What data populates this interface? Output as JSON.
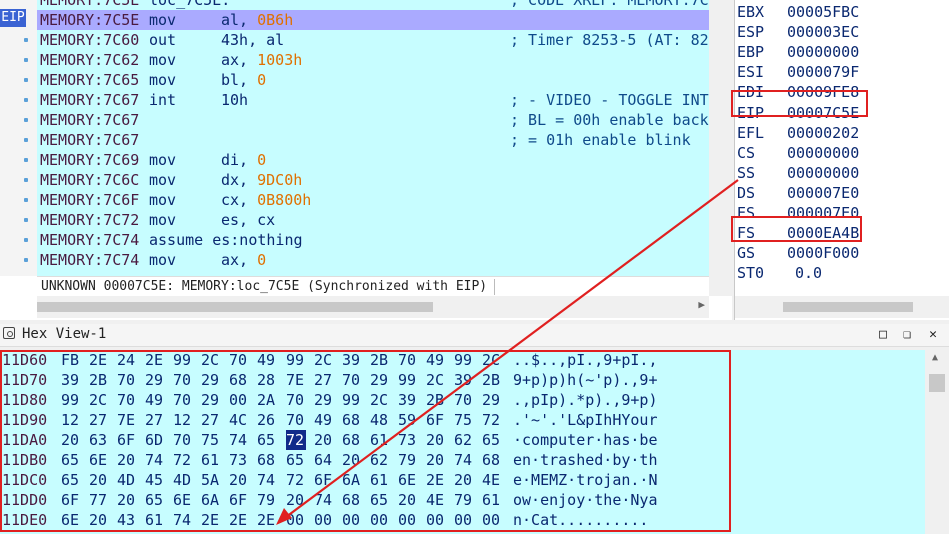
{
  "disassembly": {
    "eip_tag": "EIP",
    "lines": [
      {
        "addr": "MEMORY:7C5E",
        "mn": "loc_7C5E:",
        "op": "",
        "opnum": "",
        "cm": "; CODE XREF: MEMORY:7C"
      },
      {
        "addr": "MEMORY:7C5E",
        "mn": "mov",
        "op": "al, ",
        "opnum": "0B6h",
        "cm": ""
      },
      {
        "addr": "MEMORY:7C60",
        "mn": "out",
        "op": "43h, al",
        "opnum": "",
        "cm": "; Timer 8253-5 (AT: 82"
      },
      {
        "addr": "MEMORY:7C62",
        "mn": "mov",
        "op": "ax, ",
        "opnum": "1003h",
        "cm": ""
      },
      {
        "addr": "MEMORY:7C65",
        "mn": "mov",
        "op": "bl, ",
        "opnum": "0",
        "cm": ""
      },
      {
        "addr": "MEMORY:7C67",
        "mn": "int",
        "op": "10h",
        "opnum": "",
        "cm": "; - VIDEO - TOGGLE INT"
      },
      {
        "addr": "MEMORY:7C67",
        "mn": "",
        "op": "",
        "opnum": "",
        "cm": "; BL = 00h enable back"
      },
      {
        "addr": "MEMORY:7C67",
        "mn": "",
        "op": "",
        "opnum": "",
        "cm": "; = 01h enable blink"
      },
      {
        "addr": "MEMORY:7C69",
        "mn": "mov",
        "op": "di, ",
        "opnum": "0",
        "cm": ""
      },
      {
        "addr": "MEMORY:7C6C",
        "mn": "mov",
        "op": "dx, ",
        "opnum": "9DC0h",
        "cm": ""
      },
      {
        "addr": "MEMORY:7C6F",
        "mn": "mov",
        "op": "cx, ",
        "opnum": "0B800h",
        "cm": ""
      },
      {
        "addr": "MEMORY:7C72",
        "mn": "mov",
        "op": "es, cx",
        "opnum": "",
        "cm": ""
      },
      {
        "addr": "MEMORY:7C74",
        "mn": "assume es:nothing",
        "op": "",
        "opnum": "",
        "cm": ""
      },
      {
        "addr": "MEMORY:7C74",
        "mn": "mov",
        "op": "ax, ",
        "opnum": "0",
        "cm": ""
      }
    ],
    "status": "UNKNOWN 00007C5E: MEMORY:loc_7C5E (Synchronized with EIP)"
  },
  "registers": [
    {
      "name": "EBX",
      "value": "00005FBC"
    },
    {
      "name": "ESP",
      "value": "000003EC"
    },
    {
      "name": "EBP",
      "value": "00000000"
    },
    {
      "name": "ESI",
      "value": "0000079F"
    },
    {
      "name": "EDI",
      "value": "00009FE8"
    },
    {
      "name": "EIP",
      "value": "00007C5E"
    },
    {
      "name": "EFL",
      "value": "00000202"
    },
    {
      "name": "CS",
      "value": "00000000"
    },
    {
      "name": "SS",
      "value": "00000000"
    },
    {
      "name": "DS",
      "value": "000007E0"
    },
    {
      "name": "ES",
      "value": "000007E0"
    },
    {
      "name": "FS",
      "value": "0000EA4B"
    },
    {
      "name": "GS",
      "value": "0000F000"
    },
    {
      "name": "ST0",
      "value": "0.0"
    }
  ],
  "hexview": {
    "title": "Hex View-1",
    "selected_byte": "72",
    "rows": [
      {
        "addr": "11D60",
        "bytes": [
          "FB",
          "2E",
          "24",
          "2E",
          "99",
          "2C",
          "70",
          "49",
          "99",
          "2C",
          "39",
          "2B",
          "70",
          "49",
          "99",
          "2C"
        ],
        "ascii": "..$..,pI.,9+pI.,"
      },
      {
        "addr": "11D70",
        "bytes": [
          "39",
          "2B",
          "70",
          "29",
          "70",
          "29",
          "68",
          "28",
          "7E",
          "27",
          "70",
          "29",
          "99",
          "2C",
          "39",
          "2B"
        ],
        "ascii": "9+p)p)h(~'p).,9+"
      },
      {
        "addr": "11D80",
        "bytes": [
          "99",
          "2C",
          "70",
          "49",
          "70",
          "29",
          "00",
          "2A",
          "70",
          "29",
          "99",
          "2C",
          "39",
          "2B",
          "70",
          "29"
        ],
        "ascii": ".,pIp).*p).,9+p)"
      },
      {
        "addr": "11D90",
        "bytes": [
          "12",
          "27",
          "7E",
          "27",
          "12",
          "27",
          "4C",
          "26",
          "70",
          "49",
          "68",
          "48",
          "59",
          "6F",
          "75",
          "72"
        ],
        "ascii": ".'~'.'L&pIhHYour"
      },
      {
        "addr": "11DA0",
        "bytes": [
          "20",
          "63",
          "6F",
          "6D",
          "70",
          "75",
          "74",
          "65",
          "72",
          "20",
          "68",
          "61",
          "73",
          "20",
          "62",
          "65"
        ],
        "ascii": "·computer·has·be"
      },
      {
        "addr": "11DB0",
        "bytes": [
          "65",
          "6E",
          "20",
          "74",
          "72",
          "61",
          "73",
          "68",
          "65",
          "64",
          "20",
          "62",
          "79",
          "20",
          "74",
          "68"
        ],
        "ascii": "en·trashed·by·th"
      },
      {
        "addr": "11DC0",
        "bytes": [
          "65",
          "20",
          "4D",
          "45",
          "4D",
          "5A",
          "20",
          "74",
          "72",
          "6F",
          "6A",
          "61",
          "6E",
          "2E",
          "20",
          "4E"
        ],
        "ascii": "e·MEMZ·trojan.·N"
      },
      {
        "addr": "11DD0",
        "bytes": [
          "6F",
          "77",
          "20",
          "65",
          "6E",
          "6A",
          "6F",
          "79",
          "20",
          "74",
          "68",
          "65",
          "20",
          "4E",
          "79",
          "61"
        ],
        "ascii": "ow·enjoy·the·Nya"
      },
      {
        "addr": "11DE0",
        "bytes": [
          "6E",
          "20",
          "43",
          "61",
          "74",
          "2E",
          "2E",
          "2E",
          "00",
          "00",
          "00",
          "00",
          "00",
          "00",
          "00",
          "00"
        ],
        "ascii": "n·Cat.........."
      }
    ]
  },
  "colors": {
    "highlight": "#aaaaff",
    "code_bg": "#c7fdff",
    "annotation": "#e02020"
  }
}
